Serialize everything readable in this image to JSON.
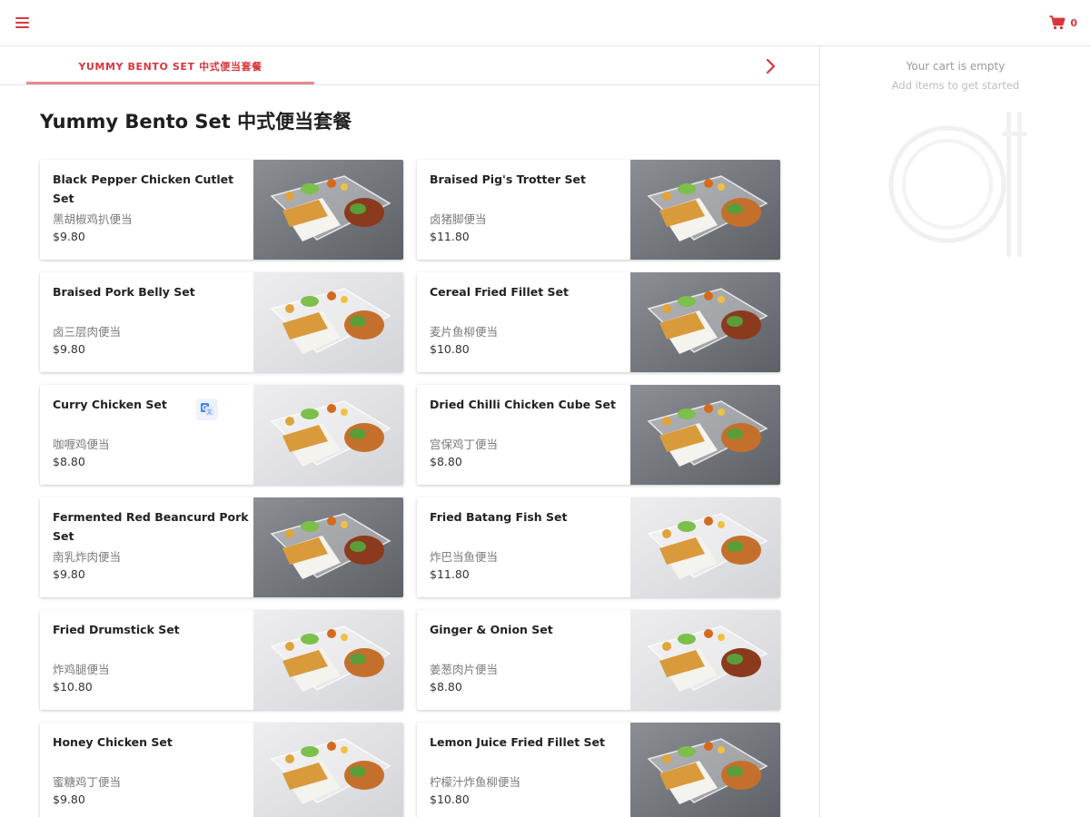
{
  "header": {
    "menu_icon": "hamburger-menu-icon",
    "cart_icon": "shopping-cart-icon",
    "cart_count": "0",
    "accent_color": "#d9363e"
  },
  "tabs": {
    "active_label": "YUMMY BENTO SET 中式便当套餐",
    "next_icon": "chevron-right-icon"
  },
  "cart": {
    "empty_text": "Your cart is empty",
    "hint_text": "Add items to get started",
    "illustration_icon": "plate-and-chopsticks-icon"
  },
  "section": {
    "title": "Yummy Bento Set 中式便当套餐"
  },
  "items": [
    {
      "name": "Black Pepper Chicken Cutlet Set",
      "name_cn": "黑胡椒鸡扒便当",
      "price": "$9.80",
      "bg": "dark"
    },
    {
      "name": "Braised Pig's Trotter Set",
      "name_cn": "卤猪脚便当",
      "price": "$11.80",
      "bg": "dark"
    },
    {
      "name": "Braised Pork Belly Set",
      "name_cn": "卤三层肉便当",
      "price": "$9.80",
      "bg": "light"
    },
    {
      "name": "Cereal Fried Fillet Set",
      "name_cn": "麦片鱼柳便当",
      "price": "$10.80",
      "bg": "dark"
    },
    {
      "name": "Curry Chicken Set",
      "name_cn": "咖喱鸡便当",
      "price": "$8.80",
      "bg": "light",
      "translate_icon": "translate-icon"
    },
    {
      "name": "Dried Chilli Chicken Cube Set",
      "name_cn": "宫保鸡丁便当",
      "price": "$8.80",
      "bg": "dark"
    },
    {
      "name": "Fermented Red Beancurd Pork Set",
      "name_cn": "南乳炸肉便当",
      "price": "$9.80",
      "bg": "dark"
    },
    {
      "name": "Fried Batang Fish Set",
      "name_cn": "炸巴当鱼便当",
      "price": "$11.80",
      "bg": "light"
    },
    {
      "name": "Fried Drumstick Set",
      "name_cn": "炸鸡腿便当",
      "price": "$10.80",
      "bg": "light"
    },
    {
      "name": "Ginger & Onion Set",
      "name_cn": "姜葱肉片便当",
      "price": "$8.80",
      "bg": "light"
    },
    {
      "name": "Honey Chicken Set",
      "name_cn": "蜜糖鸡丁便当",
      "price": "$9.80",
      "bg": "light"
    },
    {
      "name": "Lemon Juice Fried Fillet Set",
      "name_cn": "柠檬汁炸鱼柳便当",
      "price": "$10.80",
      "bg": "dark"
    }
  ]
}
